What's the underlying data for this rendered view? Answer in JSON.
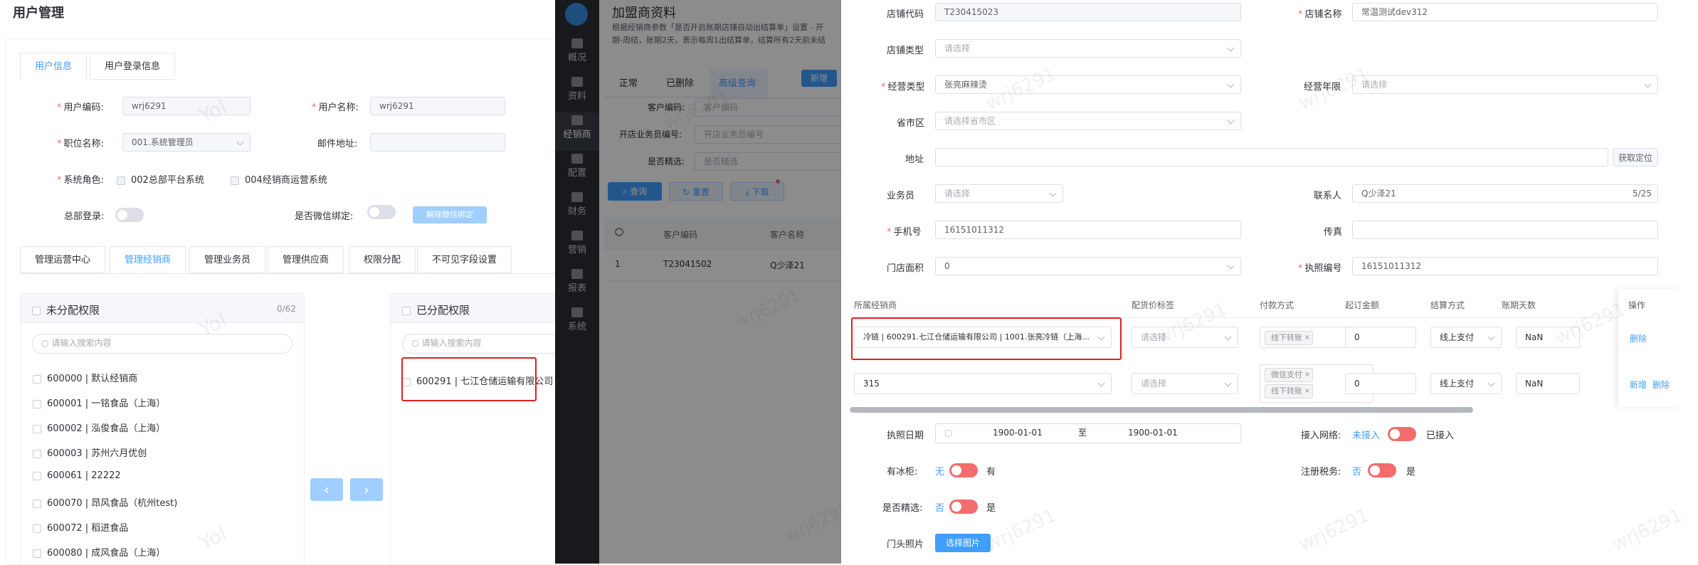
{
  "left": {
    "title": "用户管理",
    "tabs": [
      "用户信息",
      "用户登录信息"
    ],
    "form": {
      "user_code_label": "用户编码:",
      "user_code": "wrj6291",
      "user_name_label": "用户名称:",
      "user_name": "wrj6291",
      "position_label": "职位名称:",
      "position": "001.系统管理员",
      "email_label": "邮件地址:",
      "email": "",
      "role_label": "系统角色:",
      "role_1": "002总部平台系统",
      "role_2": "004经销商运营系统",
      "hq_login_label": "总部登录:",
      "wechat_bind_label": "是否微信绑定:",
      "unbind_button": "解除微信绑定"
    },
    "sub_tabs": [
      "管理运营中心",
      "管理经销商",
      "管理业务员",
      "管理供应商",
      "权限分配",
      "不可见字段设置"
    ],
    "unassigned": {
      "title": "未分配权限",
      "count": "0/62",
      "search_placeholder": "请输入搜索内容",
      "items": [
        "600000 | 默认经销商",
        "600001 | 一铭食品（上海）",
        "600002 | 泓俊食品（上海）",
        "600003 | 苏州六月优创",
        "600061 | 22222",
        "600070 | 昂风食品（杭州test)",
        "600072 | 稻进食品",
        "600080 | 成风食品（上海）"
      ]
    },
    "assigned": {
      "title": "已分配权限",
      "search_placeholder": "请输入搜索内容",
      "items": [
        "600291 | 七江仓储运输有限公司"
      ]
    },
    "transfer_left": "‹",
    "transfer_right": "›",
    "watermark": "Yol"
  },
  "middle": {
    "title": "加盟商资料",
    "desc_1": "根据经销商参数「是否开启账期店铺自动出结算单」设置 - 开",
    "desc_2": "期-周结，账期2天，表示每周1出结算单，结算所有2天前未结",
    "tabs": [
      "正常",
      "已删除",
      "高级查询"
    ],
    "new_button": "新增",
    "fields": [
      {
        "label": "客户编码:",
        "placeholder": "客户编码"
      },
      {
        "label": "开店业务员编号:",
        "placeholder": "开店业务员编号"
      },
      {
        "label": "是否精选:",
        "placeholder": "是否精选"
      }
    ],
    "query_button": "查询",
    "reset_button": "重置",
    "download_button": "下载",
    "table_headers": [
      "客户编码",
      "客户名称"
    ],
    "rows": [
      {
        "index": "1",
        "code": "T23041502",
        "name": "Q少泽21"
      }
    ],
    "sidebar": [
      "概况",
      "资料",
      "经销商",
      "配置",
      "财务",
      "营销",
      "报表",
      "系统"
    ],
    "watermark": "wrj6291"
  },
  "right": {
    "shop_code_label": "店铺代码",
    "shop_code": "T230415023",
    "shop_name_label": "店铺名称",
    "shop_name": "常温测试dev312",
    "shop_type_label": "店铺类型",
    "shop_type_placeholder": "请选择",
    "biz_type_label": "经营类型",
    "biz_type": "张亮麻辣烫",
    "biz_years_label": "经营年限",
    "biz_years_placeholder": "请选择",
    "region_label": "省市区",
    "region_placeholder": "请选择省市区",
    "address_label": "地址",
    "address": "",
    "locate_button": "获取定位",
    "salesman_label": "业务员",
    "salesman_placeholder": "请选择",
    "contact_label": "联系人",
    "contact": "Q少泽21",
    "contact_count": "5/25",
    "phone_label": "手机号",
    "phone": "16151011312",
    "fax_label": "传真",
    "fax": "",
    "area_label": "门店面积",
    "area": "0",
    "license_label": "执照编号",
    "license": "16151011312",
    "table": {
      "headers": [
        "所属经销商",
        "配货价标签",
        "付款方式",
        "起订金额",
        "结算方式",
        "账期天数",
        "操作"
      ],
      "rows": [
        {
          "dealer": "冷链 | 600291.七江仓储运输有限公司 | 1001.张亮冷链（上海...",
          "price_tag": "请选择",
          "payments": [
            "线下转账"
          ],
          "min_amount": "0",
          "settle": "线上支付",
          "days": "NaN",
          "ops": [
            "删除"
          ]
        },
        {
          "dealer": "315",
          "price_tag": "请选择",
          "payments": [
            "微信支付",
            "线下转账"
          ],
          "min_amount": "0",
          "settle": "线上支付",
          "days": "NaN",
          "ops": [
            "新增",
            "删除"
          ]
        }
      ]
    },
    "license_date_label": "执照日期",
    "license_date_start": "1900-01-01",
    "license_date_to": "至",
    "license_date_end": "1900-01-01",
    "network_label": "接入网络:",
    "network_off": "未接入",
    "network_on": "已接入",
    "freezer_label": "有冰柜:",
    "freezer_off": "无",
    "freezer_on": "有",
    "tax_label": "注册税务:",
    "tax_off": "否",
    "tax_on": "是",
    "selected_label": "是否精选:",
    "selected_off": "否",
    "selected_on": "是",
    "photo_label": "门头照片",
    "photo_button": "选择图片",
    "watermark": "wrj6291"
  },
  "colors": {
    "accent": "#409eff",
    "danger": "#f56c6c",
    "highlight": "#e02020",
    "sidebar": "#2b2f36"
  }
}
